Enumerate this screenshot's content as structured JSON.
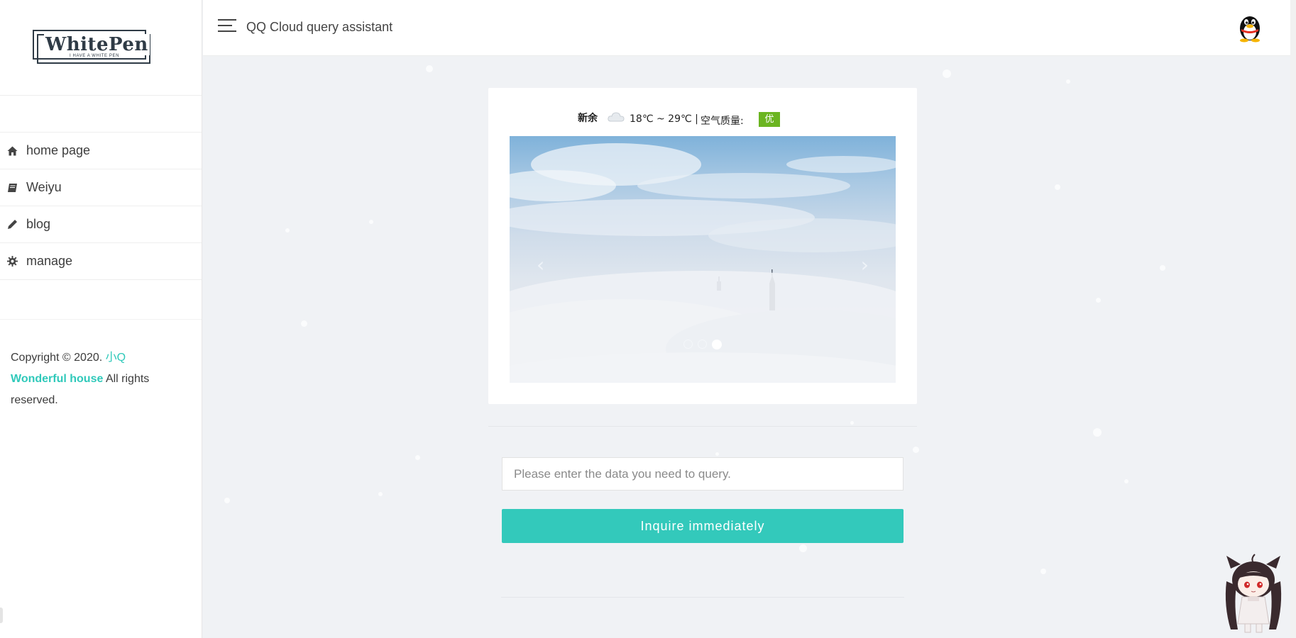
{
  "sidebar": {
    "logo": {
      "name": "WhitePen",
      "tagline": "I HAVE A WHITE PEN"
    },
    "items": [
      {
        "label": "home page",
        "icon": "home-icon"
      },
      {
        "label": "Weiyu",
        "icon": "book-icon"
      },
      {
        "label": "blog",
        "icon": "pencil-icon"
      },
      {
        "label": "manage",
        "icon": "gear-icon"
      }
    ],
    "copyright": {
      "prefix": "Copyright © 2020.",
      "author": "小Q",
      "site": "Wonderful house",
      "suffix": "All rights reserved."
    }
  },
  "topbar": {
    "title": "QQ Cloud query assistant",
    "avatar_icon": "qq-penguin-icon"
  },
  "weather": {
    "city": "新余",
    "icon": "cloud-icon",
    "temperature": "18℃ ~ 29℃",
    "separator": "|",
    "air_quality_label": "空气质量:",
    "air_quality_value": "优",
    "air_quality_color": "#6bb521"
  },
  "carousel": {
    "prev_label": "‹",
    "next_label": "›",
    "slide_count": 3,
    "active_slide": 3
  },
  "query": {
    "placeholder": "Please enter the data you need to query.",
    "value": "",
    "button_label": "Inquire immediately"
  },
  "colors": {
    "accent": "#33c9bb",
    "link": "#2fc9ba",
    "background": "#f0f2f5"
  }
}
